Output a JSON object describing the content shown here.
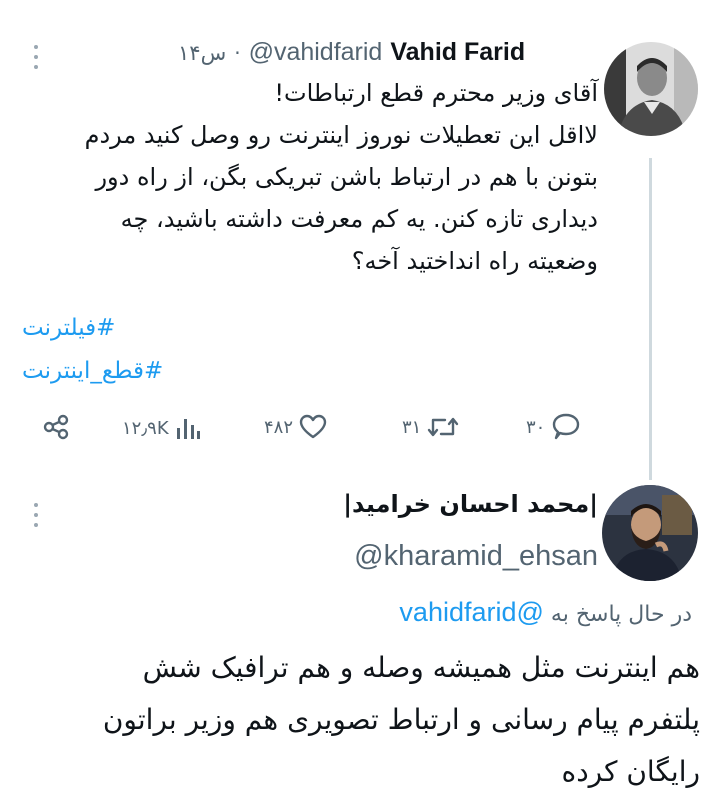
{
  "tweet": {
    "author_name": "Vahid Farid",
    "author_handle": "@vahidfarid",
    "separator": "·",
    "time": "۱۴س",
    "text_lines": [
      "آقای وزیر محترم قطع ارتباطات!",
      "لااقل این تعطیلات نوروز اینترنت رو وصل کنید مردم",
      "بتونن با هم در ارتباط باشن تبریکی بگن، از راه دور",
      "دیداری تازه کنن. یه کم معرفت داشته باشید، چه",
      "وضعیته راه انداختید آخه؟"
    ],
    "hashtags": [
      "#فیلترنت",
      "#قطع_اینترنت"
    ],
    "actions": {
      "replies": "۳۰",
      "retweets": "۳۱",
      "likes": "۴۸۲",
      "views": "۱۲٫۹K"
    },
    "icons": [
      "more-icon",
      "reply-icon",
      "retweet-icon",
      "like-icon",
      "views-icon",
      "share-icon"
    ]
  },
  "reply": {
    "author_name": "|محمد احسان خرامید|",
    "author_handle": "@kharamid_ehsan",
    "replying_prefix": "در حال پاسخ به",
    "replying_to": "@vahidfarid",
    "text_lines": [
      "هم اینترنت مثل همیشه وصله و هم ترافیک شش",
      "پلتفرم پیام رسانی و ارتباط تصویری هم وزیر براتون",
      "رایگان کرده"
    ]
  },
  "colors": {
    "link": "#1d9bf0",
    "secondary": "#536471",
    "primary_text": "#0f1419",
    "divider": "#cfd9de"
  }
}
